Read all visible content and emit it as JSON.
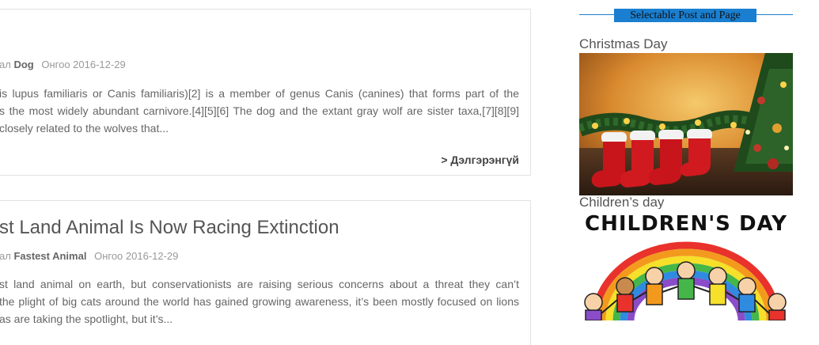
{
  "posts": [
    {
      "meta_cat_prefix": "ал",
      "meta_cat": "Dog",
      "meta_date": "Онгоо 2016-12-29",
      "excerpt_lines": [
        "is lupus familiaris or Canis familiaris)[2] is a member of genus Canis (canines) that forms part of the",
        "s the most widely abundant carnivore.[4][5][6] The dog and the extant gray wolf are sister taxa,[7][8][9]",
        "closely related to the wolves that..."
      ],
      "read_more": "> Дэлгэрэнгүй"
    },
    {
      "title": "st Land Animal Is Now Racing Extinction",
      "meta_cat_prefix": "ал",
      "meta_cat": "Fastest Animal",
      "meta_date": "Онгоо 2016-12-29",
      "excerpt_lines": [
        "st land animal on earth, but conservationists are raising serious concerns about a threat they can’t",
        "the plight of big cats around the world has gained growing awareness, it’s been mostly focused on lions",
        "as are taking the spotlight, but it’s..."
      ]
    }
  ],
  "sidebar": {
    "widget_title": "Selectable Post and Page",
    "items": [
      {
        "title": "Christmas Day"
      },
      {
        "title": "Children’s day",
        "image_text": "CHILDREN'S DAY"
      }
    ]
  },
  "colors": {
    "accent": "#1a7fd0",
    "text": "#555555",
    "muted": "#999999"
  }
}
